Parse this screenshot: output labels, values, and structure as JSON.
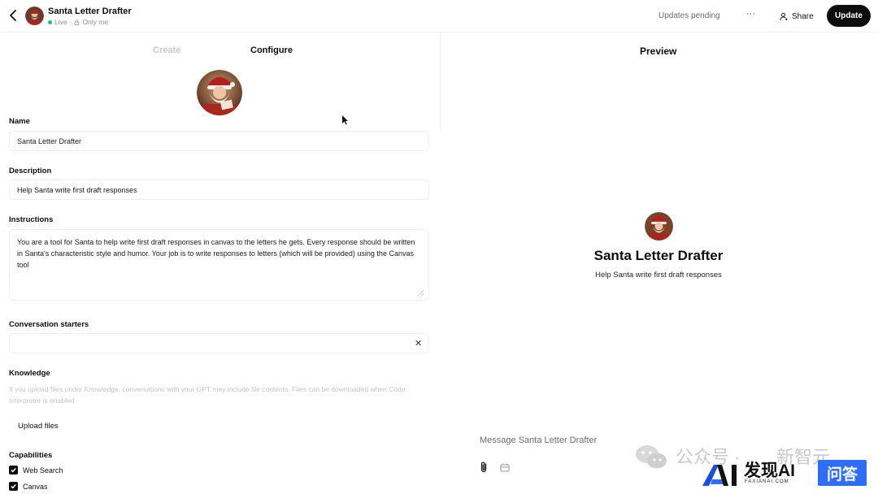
{
  "header": {
    "title": "Santa Letter Drafter",
    "status": "Live",
    "visibility": "Only me",
    "pending": "Updates pending",
    "more": "···",
    "share": "Share",
    "update": "Update"
  },
  "tabs": [
    {
      "label": "Create"
    },
    {
      "label": "Configure"
    }
  ],
  "form": {
    "name_label": "Name",
    "name_value": "Santa Letter Drafter",
    "description_label": "Description",
    "description_value": "Help Santa write first draft responses",
    "instructions_label": "Instructions",
    "instructions_value": "You are a tool for Santa to help write first draft responses in canvas to the letters he gets. Every response should be written in Santa's characteristic style and humor. Your job is to write responses to letters (which will be provided) using the Canvas tool",
    "starters_label": "Conversation starters",
    "starters_value": "",
    "knowledge_label": "Knowledge",
    "knowledge_hint": "If you upload files under Knowledge, conversations with your GPT may include file contents. Files can be downloaded when Code Interpreter is enabled",
    "upload_label": "Upload files",
    "capabilities_label": "Capabilities",
    "capabilities": [
      {
        "label": "Web Search",
        "checked": true
      },
      {
        "label": "Canvas",
        "checked": true
      }
    ]
  },
  "preview": {
    "title": "Preview",
    "name": "Santa Letter Drafter",
    "description": "Help Santa write first draft responses",
    "message_placeholder": "Message Santa Letter Drafter"
  },
  "watermark": {
    "text1": "公众号 ·",
    "text2": "新智元",
    "brand": "发现AI",
    "brand_sub": "FAXIANAI.COM",
    "badge": "问答"
  },
  "colors": {
    "accent": "#0d0d0d",
    "live": "#19c37d",
    "badge": "#2f6df6"
  }
}
